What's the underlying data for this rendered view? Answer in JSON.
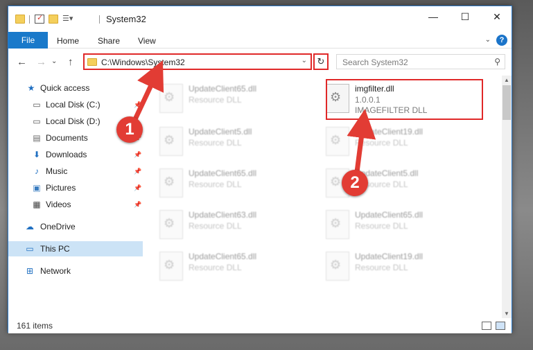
{
  "window": {
    "title": "System32"
  },
  "ribbon": {
    "file_tab": "File",
    "tabs": [
      "Home",
      "Share",
      "View"
    ],
    "help": "?"
  },
  "address": {
    "path": "C:\\Windows\\System32",
    "refresh": "↻",
    "search_placeholder": "Search System32"
  },
  "nav": {
    "items": [
      {
        "label": "Quick access",
        "icon": "star-icon",
        "pinned": false
      },
      {
        "label": "Local Disk (C:)",
        "icon": "drive-icon",
        "pinned": true
      },
      {
        "label": "Local Disk (D:)",
        "icon": "drive-icon",
        "pinned": false
      },
      {
        "label": "Documents",
        "icon": "documents-icon",
        "pinned": true
      },
      {
        "label": "Downloads",
        "icon": "download-icon",
        "pinned": true
      },
      {
        "label": "Music",
        "icon": "music-icon",
        "pinned": true
      },
      {
        "label": "Pictures",
        "icon": "pictures-icon",
        "pinned": true
      },
      {
        "label": "Videos",
        "icon": "videos-icon",
        "pinned": true
      },
      {
        "label": "OneDrive",
        "icon": "cloud-icon",
        "pinned": false
      },
      {
        "label": "This PC",
        "icon": "pc-icon",
        "pinned": false,
        "selected": true
      },
      {
        "label": "Network",
        "icon": "network-icon",
        "pinned": false
      }
    ]
  },
  "files": {
    "highlighted": {
      "name": "imgfilter.dll",
      "version": "1.0.0.1",
      "description": "IMAGEFILTER DLL"
    },
    "items": [
      {
        "name": "UpdateClient65.dll",
        "type": "Resource DLL"
      },
      {
        "name": "UpdateClient5.dll",
        "type": "Resource DLL"
      },
      {
        "name": "UpdateClient19.dll",
        "type": "Resource DLL"
      },
      {
        "name": "UpdateClient65.dll",
        "type": "Resource DLL"
      },
      {
        "name": "UpdateClient5.dll",
        "type": "Resource DLL"
      },
      {
        "name": "UpdateClient63.dll",
        "type": "Resource DLL"
      },
      {
        "name": "UpdateClient65.dll",
        "type": "Resource DLL"
      },
      {
        "name": "UpdateClient65.dll",
        "type": "Resource DLL"
      },
      {
        "name": "UpdateClient19.dll",
        "type": "Resource DLL"
      }
    ]
  },
  "status": {
    "item_count": "161 items"
  },
  "callouts": [
    "1",
    "2"
  ],
  "colors": {
    "accent": "#1979ca",
    "highlight": "#e02828",
    "selected_nav": "#cce3f6"
  }
}
